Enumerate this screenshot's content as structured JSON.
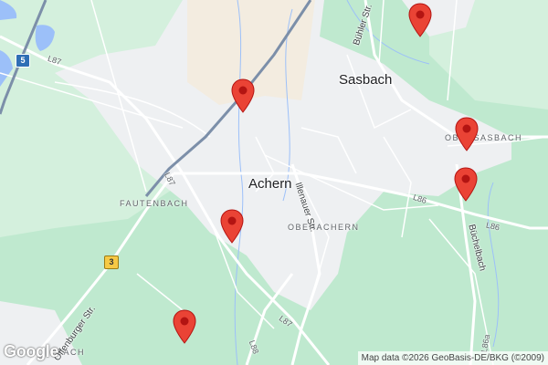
{
  "map": {
    "places": {
      "achern": "Achern",
      "sasbach": "Sasbach",
      "fautenbach": "FAUTENBACH",
      "oberachern": "OBERACHERN",
      "obersasbach": "OBERSASBACH",
      "bottom_left": "BACH"
    },
    "streets": {
      "buhler": "Bühler Str.",
      "illenauer": "Illenauer Str.",
      "offenburger": "Offenburger Str.",
      "buchelbach": "Büchelbach"
    },
    "road_labels": {
      "l87_top": "L87",
      "l87_left": "L87",
      "l87_bottom": "L87",
      "l86_east": "L86",
      "l86_far": "L86",
      "l86a": "L86a",
      "l88": "L88"
    },
    "shields": {
      "a5": "5",
      "b3": "3"
    },
    "markers": [
      {
        "name": "marker-1"
      },
      {
        "name": "marker-2"
      },
      {
        "name": "marker-3"
      },
      {
        "name": "marker-4"
      },
      {
        "name": "marker-5"
      },
      {
        "name": "marker-6"
      },
      {
        "name": "marker-7"
      }
    ],
    "attribution": "Map data ©2026 GeoBasis-DE/BKG (©2009)",
    "logo": "Google",
    "colors": {
      "forest": "#bfe9cf",
      "urban": "#eef0f2",
      "industrial": "#f3ece0",
      "water": "#9cc0f9",
      "highway": "#7c8fa9",
      "marker": "#ea4335"
    }
  }
}
